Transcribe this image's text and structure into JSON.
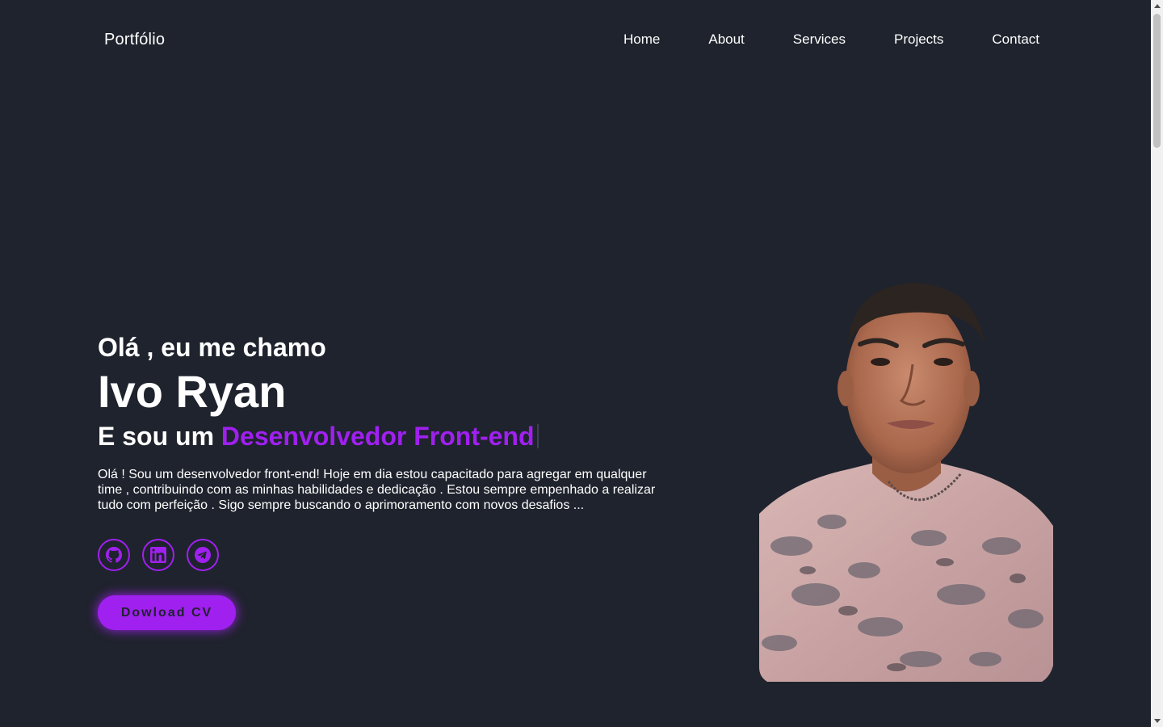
{
  "header": {
    "logo": "Portfólio",
    "nav": [
      "Home",
      "About",
      "Services",
      "Projects",
      "Contact"
    ]
  },
  "hero": {
    "greeting": "Olá , eu me chamo",
    "name": "Ivo Ryan",
    "role_prefix": "E sou um ",
    "role_highlight": "Desenvolvedor Front-end",
    "description": "Olá ! Sou um desenvolvedor front-end! Hoje em dia estou capacitado para agregar em qualquer time , contribuindo com as minhas habilidades e dedicação . Estou sempre empenhado a realizar tudo com perfeição . Sigo sempre buscando o aprimoramento com novos desafios ...",
    "socials": [
      "github-icon",
      "linkedin-icon",
      "telegram-icon"
    ],
    "cv_button": "Dowload CV"
  },
  "colors": {
    "background": "#1f232d",
    "accent": "#a020f0",
    "text": "#ffffff"
  }
}
